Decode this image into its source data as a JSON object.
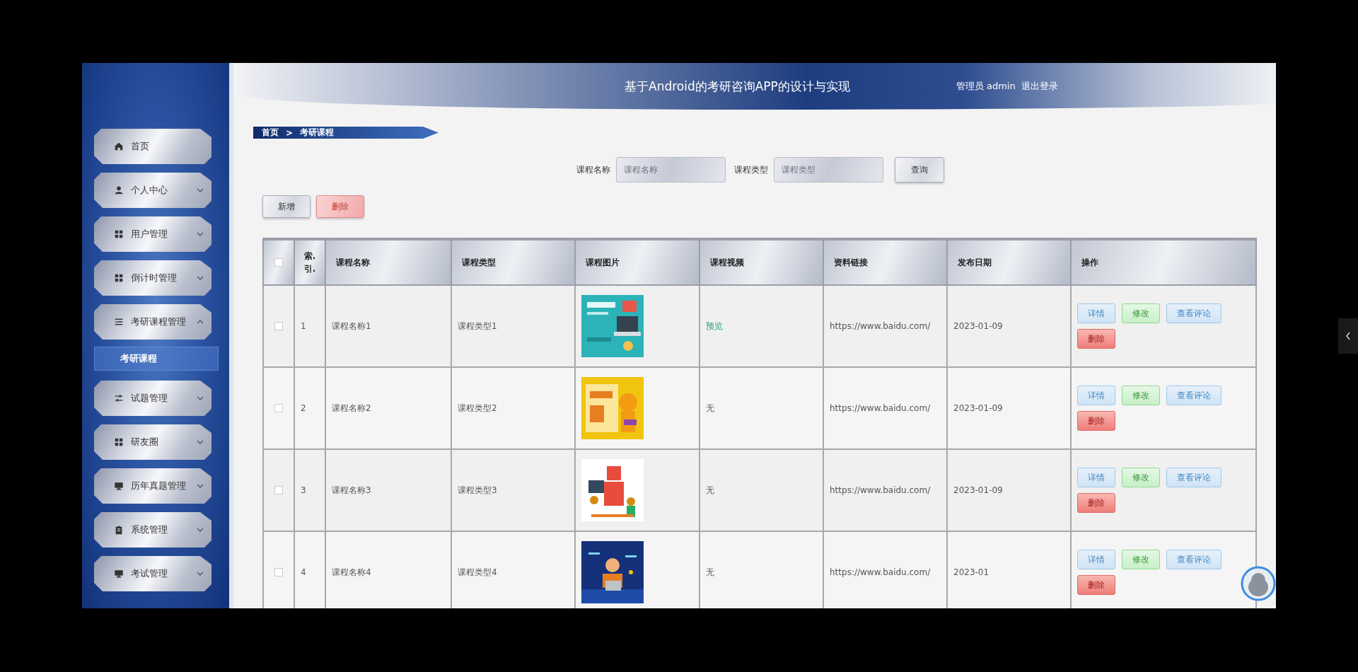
{
  "header": {
    "title": "基于Android的考研咨询APP的设计与实现",
    "user": "管理员 admin",
    "logout": "退出登录"
  },
  "sidebar": {
    "items": [
      {
        "label": "首页",
        "kind": "link"
      },
      {
        "label": "个人中心",
        "kind": "menu",
        "expanded": false
      },
      {
        "label": "用户管理",
        "kind": "menu",
        "expanded": false
      },
      {
        "label": "倒计时管理",
        "kind": "menu",
        "expanded": false
      },
      {
        "label": "考研课程管理",
        "kind": "menu",
        "expanded": true,
        "children": [
          {
            "label": "考研课程",
            "selected": true
          }
        ]
      },
      {
        "label": "试题管理",
        "kind": "menu",
        "expanded": false
      },
      {
        "label": "研友圈",
        "kind": "menu",
        "expanded": false
      },
      {
        "label": "历年真题管理",
        "kind": "menu",
        "expanded": false
      },
      {
        "label": "系统管理",
        "kind": "menu",
        "expanded": false
      },
      {
        "label": "考试管理",
        "kind": "menu",
        "expanded": false
      }
    ]
  },
  "breadcrumb": [
    "首页",
    ">",
    "考研课程"
  ],
  "search": {
    "fields": [
      {
        "label": "课程名称",
        "placeholder": "课程名称"
      },
      {
        "label": "课程类型",
        "placeholder": "课程类型"
      }
    ],
    "button": "查询"
  },
  "toolbar": [
    {
      "label": "新增",
      "kind": "default"
    },
    {
      "label": "删除",
      "kind": "danger"
    }
  ],
  "table": {
    "select_all": {
      "checked": false
    },
    "columns": [
      "索.引.",
      "课程名称",
      "课程类型",
      "课程图片",
      "课程视频",
      "资料链接",
      "发布日期",
      "操作"
    ],
    "rows": [
      {
        "checked": false,
        "index": "1",
        "name": "课程名称1",
        "type": "课程类型1",
        "video": {
          "text": "预览",
          "kind": "link"
        },
        "link": "https://www.baidu.com/",
        "date": "2023-01-09",
        "actions": [
          {
            "label": "详情",
            "kind": "info"
          },
          {
            "label": "修改",
            "kind": "success"
          },
          {
            "label": "查看评论",
            "kind": "info"
          },
          {
            "label": "删除",
            "kind": "danger"
          }
        ]
      },
      {
        "checked": false,
        "index": "2",
        "name": "课程名称2",
        "type": "课程类型2",
        "video": {
          "text": "无",
          "kind": "none"
        },
        "link": "https://www.baidu.com/",
        "date": "2023-01-09",
        "actions": [
          {
            "label": "详情",
            "kind": "info"
          },
          {
            "label": "修改",
            "kind": "success"
          },
          {
            "label": "查看评论",
            "kind": "info"
          },
          {
            "label": "删除",
            "kind": "danger"
          }
        ]
      },
      {
        "checked": false,
        "index": "3",
        "name": "课程名称3",
        "type": "课程类型3",
        "video": {
          "text": "无",
          "kind": "none"
        },
        "link": "https://www.baidu.com/",
        "date": "2023-01-09",
        "actions": [
          {
            "label": "详情",
            "kind": "info"
          },
          {
            "label": "修改",
            "kind": "success"
          },
          {
            "label": "查看评论",
            "kind": "info"
          },
          {
            "label": "删除",
            "kind": "danger"
          }
        ]
      },
      {
        "checked": false,
        "index": "4",
        "name": "课程名称4",
        "type": "课程类型4",
        "video": {
          "text": "无",
          "kind": "none"
        },
        "link": "https://www.baidu.com/",
        "date": "2023-01",
        "actions": [
          {
            "label": "详情",
            "kind": "info"
          },
          {
            "label": "修改",
            "kind": "success"
          },
          {
            "label": "查看评论",
            "kind": "info"
          },
          {
            "label": "删除",
            "kind": "danger"
          }
        ]
      }
    ]
  }
}
